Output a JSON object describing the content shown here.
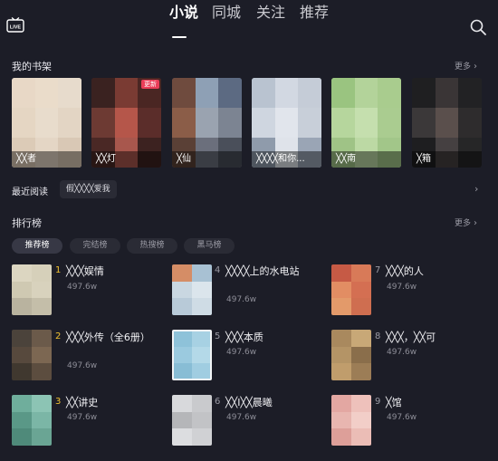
{
  "header": {
    "live_icon": "live-tv-icon",
    "live_text": "LIVE",
    "tabs": [
      {
        "label": "小说",
        "active": true
      },
      {
        "label": "同城",
        "active": false
      },
      {
        "label": "关注",
        "active": false
      },
      {
        "label": "推荐",
        "active": false
      }
    ],
    "search_icon": "search-icon"
  },
  "shelf": {
    "title": "我的书架",
    "more": "更多",
    "books": [
      {
        "caption": "╳╳者",
        "badge": ""
      },
      {
        "caption": "╳╳灯",
        "badge": "更新"
      },
      {
        "caption": "╳仙",
        "badge": ""
      },
      {
        "caption": "╳╳╳╳和你...",
        "badge": ""
      },
      {
        "caption": "╳╳南",
        "badge": ""
      },
      {
        "caption": "╳箱",
        "badge": ""
      }
    ]
  },
  "recent": {
    "label": "最近阅读",
    "item": "假╳╳╳╳爱我"
  },
  "ranking": {
    "title": "排行榜",
    "more": "更多",
    "filters": [
      {
        "label": "推荐榜",
        "active": true
      },
      {
        "label": "完结榜",
        "active": false
      },
      {
        "label": "热搜榜",
        "active": false
      },
      {
        "label": "黑马榜",
        "active": false
      }
    ],
    "items": [
      {
        "rank": "1",
        "title": "╳╳╳娱情",
        "count": "497.6w"
      },
      {
        "rank": "2",
        "title": "╳╳╳外传（全6册）",
        "count": "497.6w"
      },
      {
        "rank": "3",
        "title": "╳╳讲史",
        "count": "497.6w"
      },
      {
        "rank": "4",
        "title": "╳╳╳╳上的水电站",
        "count": "497.6w"
      },
      {
        "rank": "5",
        "title": "╳╳╳本质",
        "count": "497.6w"
      },
      {
        "rank": "6",
        "title": "╳╳I╳╳晨曦",
        "count": "497.6w"
      },
      {
        "rank": "7",
        "title": "╳╳╳的人",
        "count": "497.6w"
      },
      {
        "rank": "8",
        "title": "╳╳╳，╳╳可",
        "count": "497.6w"
      },
      {
        "rank": "9",
        "title": "╳馆",
        "count": "497.6w"
      }
    ]
  },
  "colors": {
    "background": "#1c1d27",
    "top_rank_number": "#f2c230",
    "other_rank_number": "#9a9aa4",
    "update_badge": "#ea3d58"
  }
}
